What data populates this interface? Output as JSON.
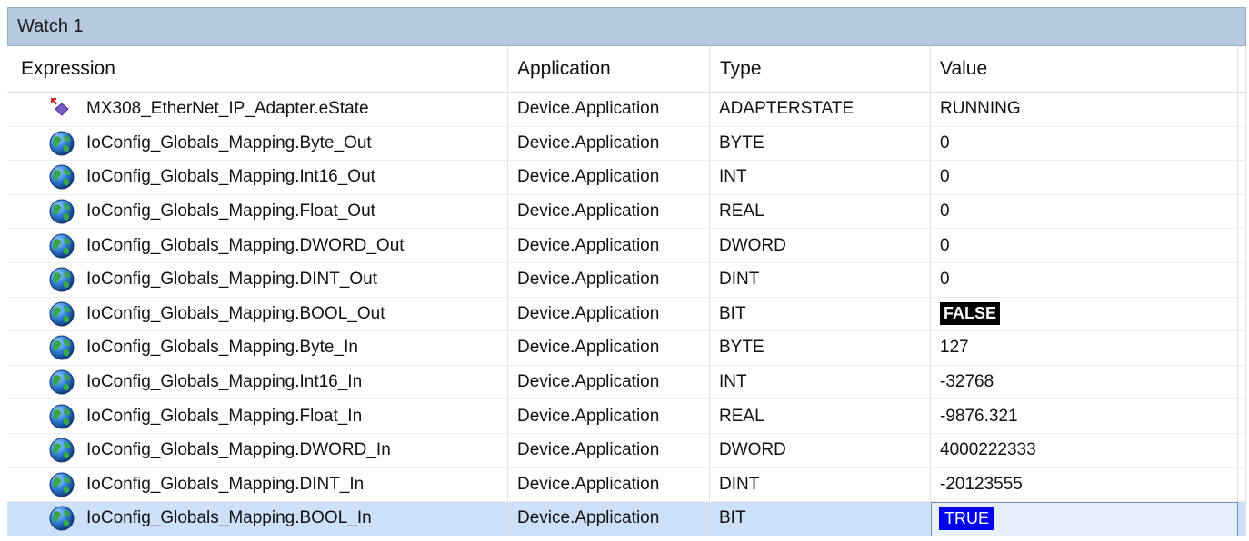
{
  "window": {
    "title": "Watch 1"
  },
  "columns": {
    "expression": "Expression",
    "application": "Application",
    "type": "Type",
    "value": "Value"
  },
  "rows": [
    {
      "expression": "MX308_EtherNet_IP_Adapter.eState",
      "application": "Device.Application",
      "type": "ADAPTERSTATE",
      "value": "RUNNING",
      "icon": "enum-variable-icon"
    },
    {
      "expression": "IoConfig_Globals_Mapping.Byte_Out",
      "application": "Device.Application",
      "type": "BYTE",
      "value": "0",
      "icon": "global-variable-icon"
    },
    {
      "expression": "IoConfig_Globals_Mapping.Int16_Out",
      "application": "Device.Application",
      "type": "INT",
      "value": "0",
      "icon": "global-variable-icon"
    },
    {
      "expression": "IoConfig_Globals_Mapping.Float_Out",
      "application": "Device.Application",
      "type": "REAL",
      "value": "0",
      "icon": "global-variable-icon"
    },
    {
      "expression": "IoConfig_Globals_Mapping.DWORD_Out",
      "application": "Device.Application",
      "type": "DWORD",
      "value": "0",
      "icon": "global-variable-icon"
    },
    {
      "expression": "IoConfig_Globals_Mapping.DINT_Out",
      "application": "Device.Application",
      "type": "DINT",
      "value": "0",
      "icon": "global-variable-icon"
    },
    {
      "expression": "IoConfig_Globals_Mapping.BOOL_Out",
      "application": "Device.Application",
      "type": "BIT",
      "value": "FALSE",
      "icon": "global-variable-icon"
    },
    {
      "expression": "IoConfig_Globals_Mapping.Byte_In",
      "application": "Device.Application",
      "type": "BYTE",
      "value": "127",
      "icon": "global-variable-icon"
    },
    {
      "expression": "IoConfig_Globals_Mapping.Int16_In",
      "application": "Device.Application",
      "type": "INT",
      "value": "-32768",
      "icon": "global-variable-icon"
    },
    {
      "expression": "IoConfig_Globals_Mapping.Float_In",
      "application": "Device.Application",
      "type": "REAL",
      "value": "-9876.321",
      "icon": "global-variable-icon"
    },
    {
      "expression": "IoConfig_Globals_Mapping.DWORD_In",
      "application": "Device.Application",
      "type": "DWORD",
      "value": "4000222333",
      "icon": "global-variable-icon"
    },
    {
      "expression": "IoConfig_Globals_Mapping.DINT_In",
      "application": "Device.Application",
      "type": "DINT",
      "value": "-20123555",
      "icon": "global-variable-icon"
    },
    {
      "expression": "IoConfig_Globals_Mapping.BOOL_In",
      "application": "Device.Application",
      "type": "BIT",
      "value": "TRUE",
      "icon": "global-variable-icon"
    }
  ],
  "colors": {
    "titlebar": "#b7cbe0",
    "selected_row": "#cce1f7",
    "false_bg": "#000000",
    "true_bg": "#0000ee"
  }
}
